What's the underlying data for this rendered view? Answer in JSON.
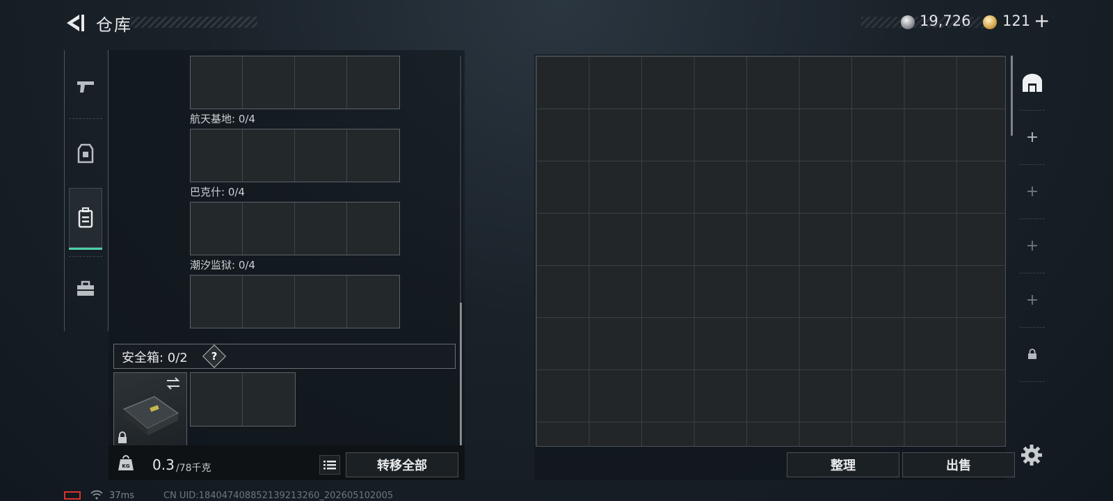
{
  "header": {
    "title": "仓库",
    "currencies": [
      {
        "icon": "silver-coin-icon",
        "amount": "19,726"
      },
      {
        "icon": "gold-coin-icon",
        "amount": "121",
        "plus": "+"
      }
    ]
  },
  "left_categories": [
    {
      "icon": "pistol-icon",
      "active": false
    },
    {
      "icon": "armor-vest-icon",
      "active": false
    },
    {
      "icon": "backpack-icon",
      "active": true
    },
    {
      "icon": "toolbox-icon",
      "active": false
    }
  ],
  "container_sections": [
    {
      "label": "航天基地: 0/4"
    },
    {
      "label": "巴克什: 0/4"
    },
    {
      "label": "潮汐监狱: 0/4"
    }
  ],
  "safe_box": {
    "label": "安全箱:  0/2",
    "help": "?"
  },
  "weight": {
    "current": "0.3",
    "max": "/78千克"
  },
  "buttons": {
    "transfer_all": "转移全部",
    "sort": "整理",
    "sell": "出售"
  },
  "side_tabs": [
    {
      "icon": "stash-house-icon"
    },
    {
      "icon": "add-icon",
      "label": "+"
    },
    {
      "icon": "add-icon",
      "label": "+"
    },
    {
      "icon": "add-icon",
      "label": "+"
    },
    {
      "icon": "add-icon",
      "label": "+"
    },
    {
      "icon": "lock-icon"
    }
  ],
  "status": {
    "ping": "37ms",
    "uid": "CN UID:18404740885213921326​0_202605102005"
  },
  "colors": {
    "accent": "#4fd1a8",
    "battery": "#d8322e"
  }
}
